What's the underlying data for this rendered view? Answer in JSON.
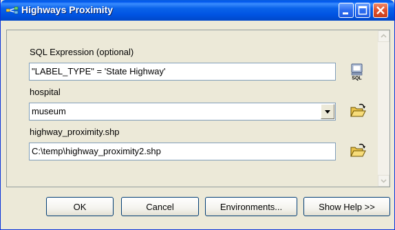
{
  "window": {
    "title": "Highways Proximity"
  },
  "form": {
    "sql": {
      "label": "SQL Expression (optional)",
      "value": "\"LABEL_TYPE\" = 'State Highway'",
      "button_icon": "sql-query-builder-icon"
    },
    "input": {
      "label": "hospital",
      "value": "museum",
      "dropdown_icon": "chevron-down-icon",
      "browse_icon": "open-folder-icon"
    },
    "output": {
      "label": "highway_proximity.shp",
      "value": "C:\\temp\\highway_proximity2.shp",
      "browse_icon": "open-folder-icon"
    }
  },
  "buttons": {
    "ok": "OK",
    "cancel": "Cancel",
    "environments": "Environments...",
    "help": "Show Help >>"
  },
  "colors": {
    "titlebar": "#0054e3",
    "dialog_bg": "#ece9d8",
    "close_button": "#e2502b"
  }
}
